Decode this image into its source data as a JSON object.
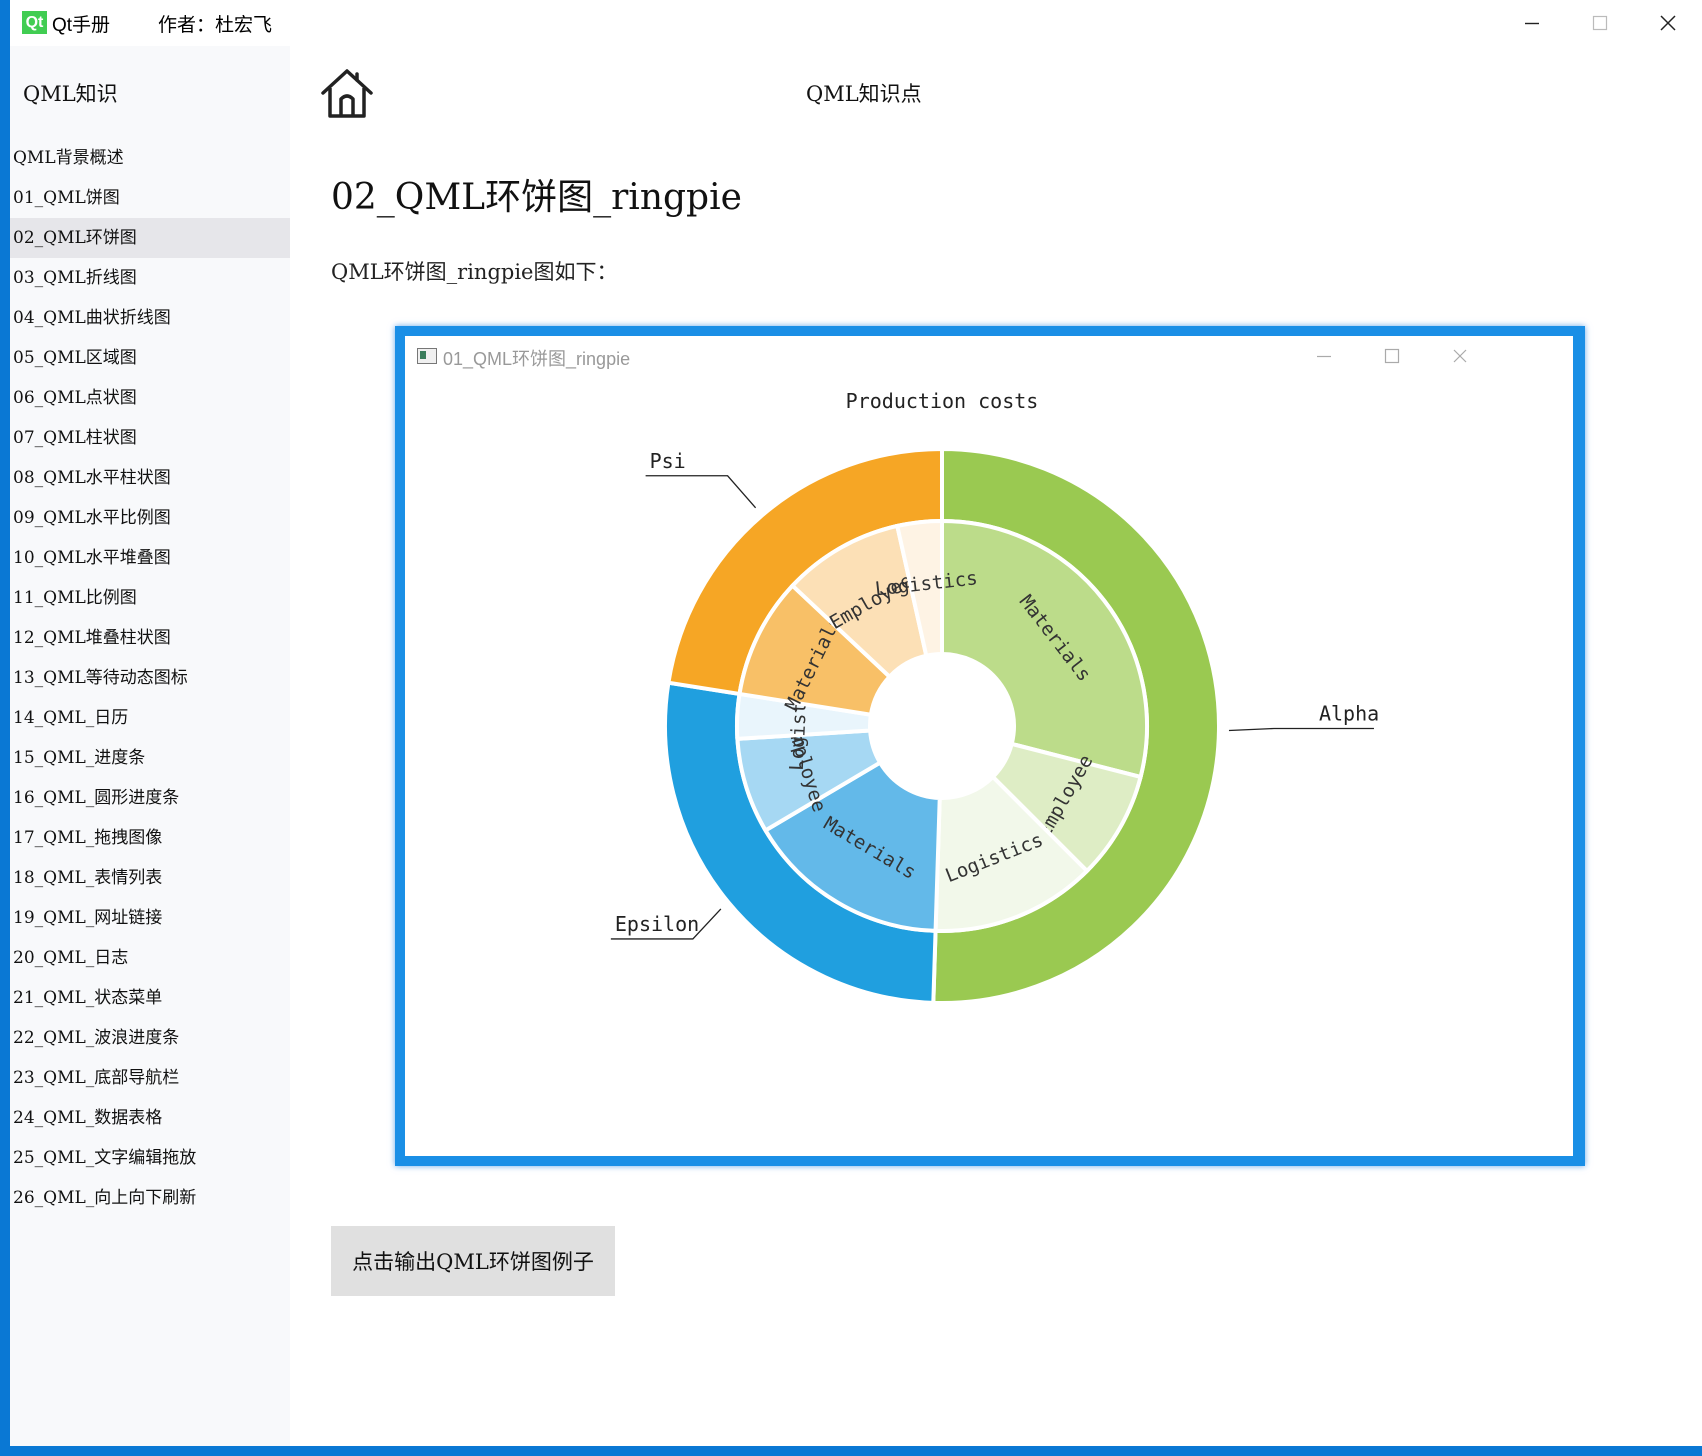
{
  "titlebar": {
    "logo_text": "Qt",
    "app_title": "Qt手册",
    "author": "作者：杜宏飞"
  },
  "sidebar": {
    "title": "QML知识",
    "items": [
      {
        "label": "QML背景概述"
      },
      {
        "label": "01_QML饼图"
      },
      {
        "label": "02_QML环饼图",
        "active": true
      },
      {
        "label": "03_QML折线图"
      },
      {
        "label": "04_QML曲状折线图"
      },
      {
        "label": "05_QML区域图"
      },
      {
        "label": "06_QML点状图"
      },
      {
        "label": "07_QML柱状图"
      },
      {
        "label": "08_QML水平柱状图"
      },
      {
        "label": "09_QML水平比例图"
      },
      {
        "label": "10_QML水平堆叠图"
      },
      {
        "label": "11_QML比例图"
      },
      {
        "label": "12_QML堆叠柱状图"
      },
      {
        "label": "13_QML等待动态图标"
      },
      {
        "label": "14_QML_日历"
      },
      {
        "label": "15_QML_进度条"
      },
      {
        "label": "16_QML_圆形进度条"
      },
      {
        "label": "17_QML_拖拽图像"
      },
      {
        "label": "18_QML_表情列表"
      },
      {
        "label": "19_QML_网址链接"
      },
      {
        "label": "20_QML_日志"
      },
      {
        "label": "21_QML_状态菜单"
      },
      {
        "label": "22_QML_波浪进度条"
      },
      {
        "label": "23_QML_底部导航栏"
      },
      {
        "label": "24_QML_数据表格"
      },
      {
        "label": "25_QML_文字编辑拖放"
      },
      {
        "label": "26_QML_向上向下刷新"
      }
    ]
  },
  "header": {
    "home_icon": "home-icon",
    "title": "QML知识点"
  },
  "content": {
    "page_title": "02_QML环饼图_ringpie",
    "description": "QML环饼图_ringpie图如下：",
    "action_button": "点击输出QML环饼图例子"
  },
  "screenshot": {
    "window_title": "01_QML环饼图_ringpie"
  },
  "chart_data": {
    "type": "pie",
    "title": "Production costs",
    "outer_ring": [
      {
        "name": "Alpha",
        "value": 50.5,
        "color": "#9ac951"
      },
      {
        "name": "Epsilon",
        "value": 27.0,
        "color": "#209fdf"
      },
      {
        "name": "Psi",
        "value": 22.5,
        "color": "#f6a625"
      }
    ],
    "inner_ring": [
      {
        "group": "Alpha",
        "name": "Materials",
        "value": 29.0,
        "color": "#bcdc8a"
      },
      {
        "group": "Alpha",
        "name": "Employee",
        "value": 8.5,
        "color": "#deedc5"
      },
      {
        "group": "Alpha",
        "name": "Logistics",
        "value": 13.0,
        "color": "#f2f8ea"
      },
      {
        "group": "Epsilon",
        "name": "Materials",
        "value": 16.0,
        "color": "#63b9e9"
      },
      {
        "group": "Epsilon",
        "name": "Employee",
        "value": 7.5,
        "color": "#a6d8f3"
      },
      {
        "group": "Epsilon",
        "name": "Logistics",
        "value": 3.5,
        "color": "#e9f5fc"
      },
      {
        "group": "Psi",
        "name": "Materials",
        "value": 9.5,
        "color": "#f8c067"
      },
      {
        "group": "Psi",
        "name": "Employee",
        "value": 9.5,
        "color": "#fce0b6"
      },
      {
        "group": "Psi",
        "name": "Logistics",
        "value": 3.5,
        "color": "#fef3e4"
      }
    ]
  }
}
